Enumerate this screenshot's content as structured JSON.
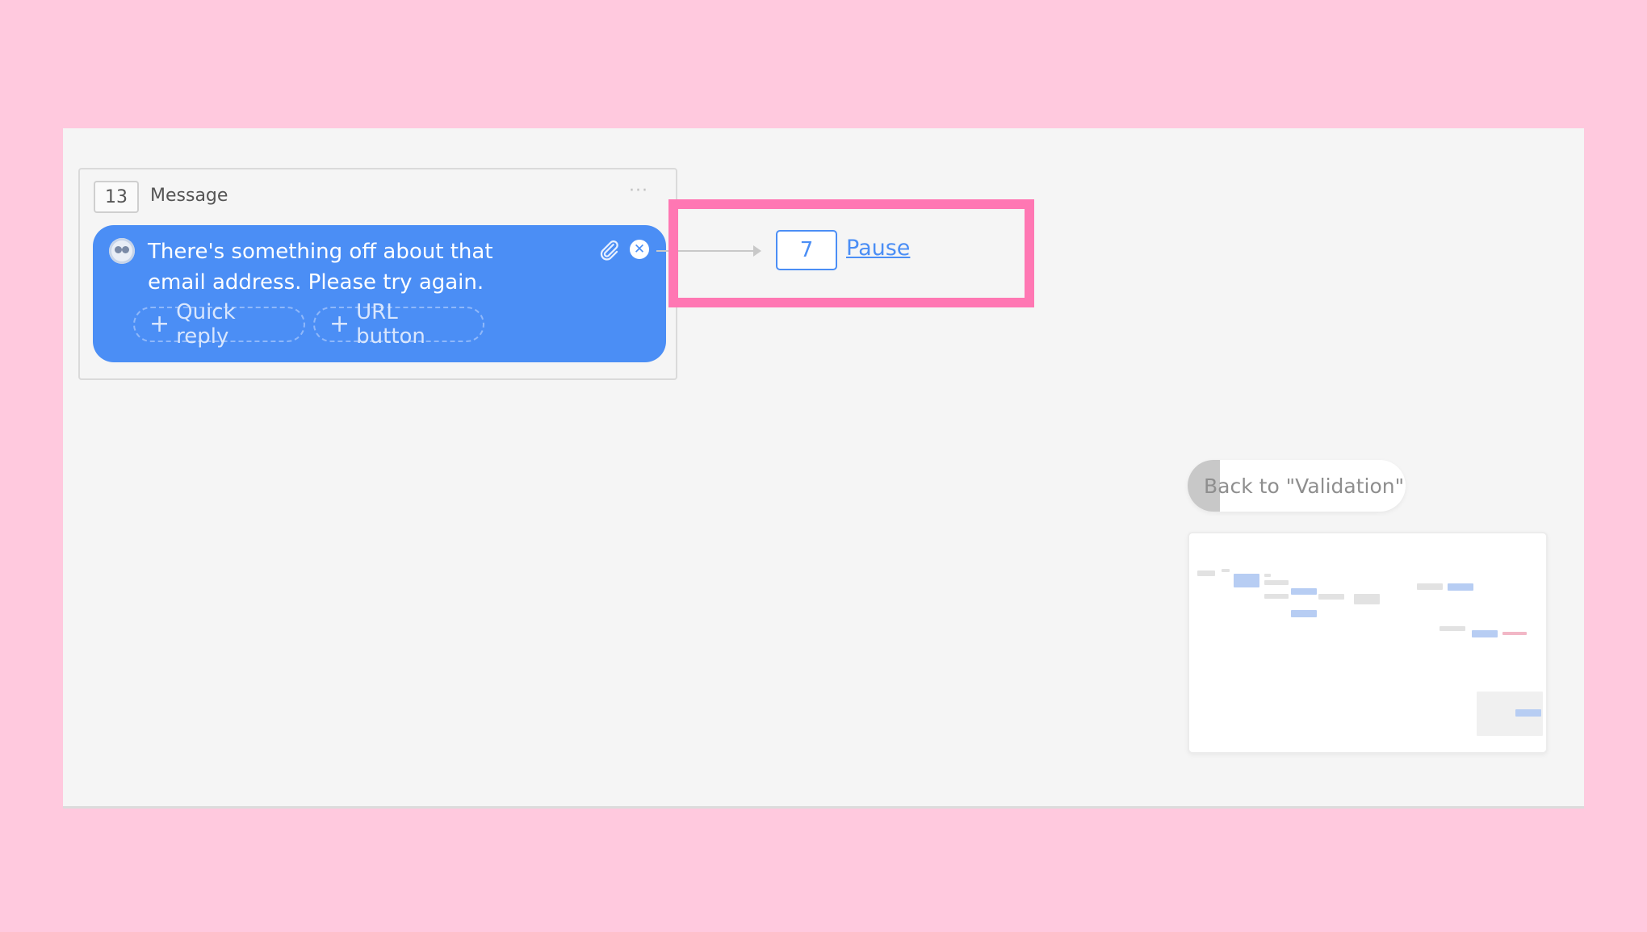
{
  "card": {
    "id": "13",
    "type": "Message",
    "menu": "···",
    "message": "There's something off about that email address. Please try again.",
    "chips": {
      "quick_reply": "Quick reply",
      "url_button": "URL button",
      "plus": "+"
    },
    "remove_glyph": "✕"
  },
  "target": {
    "id": "7",
    "label": "Pause"
  },
  "back_button": {
    "label": "Back to \"Validation\""
  },
  "colors": {
    "background": "#ffc9de",
    "canvas": "#f5f5f5",
    "bubble": "#4b8ef5",
    "highlight": "#ff77b3",
    "link": "#4b8ef5"
  },
  "icons": [
    "bot-avatar-icon",
    "paperclip-icon",
    "close-circle-icon",
    "more-horizontal-icon",
    "plus-icon"
  ]
}
